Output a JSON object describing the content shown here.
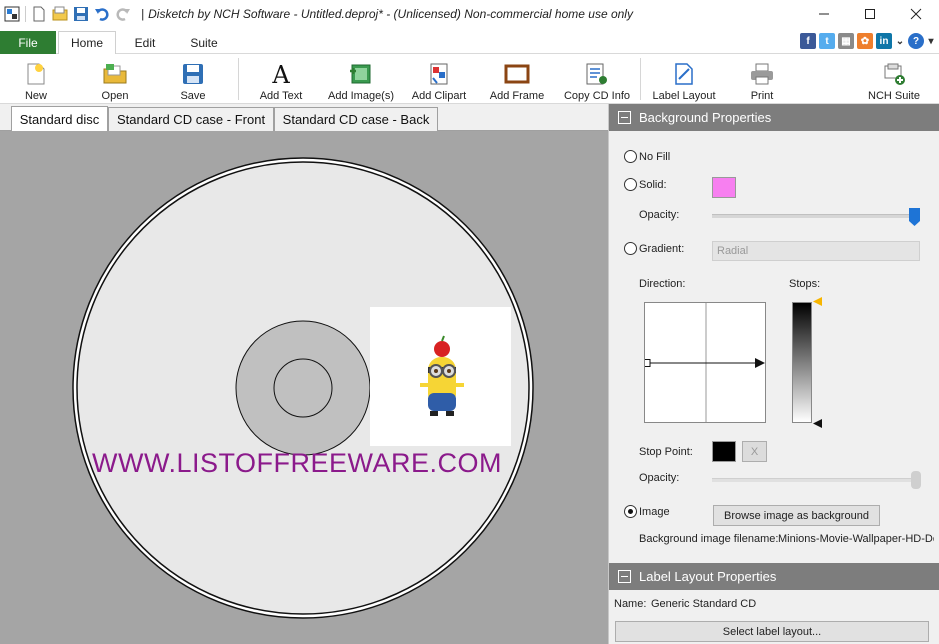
{
  "window": {
    "title": "Disketch by NCH Software - Untitled.deproj* - (Unlicensed) Non-commercial home use only",
    "separator": "|"
  },
  "menu": {
    "file": "File",
    "tabs": [
      "Home",
      "Edit",
      "Suite"
    ]
  },
  "toolbar": {
    "new": "New",
    "open": "Open",
    "save": "Save",
    "add_text": "Add Text",
    "add_images": "Add Image(s)",
    "add_clipart": "Add Clipart",
    "add_frame": "Add Frame",
    "copy_cd_info": "Copy CD Info",
    "label_layout": "Label Layout",
    "print": "Print",
    "nch_suite": "NCH Suite"
  },
  "doc_tabs": [
    "Standard disc",
    "Standard CD case - Front",
    "Standard CD case - Back"
  ],
  "canvas": {
    "watermark": "WWW.LISTOFFREEWARE.COM",
    "watermark_color": "#8b1a8b",
    "disc_color": "#e8e8e8",
    "background_color": "#a5a5a5"
  },
  "background_properties": {
    "header": "Background Properties",
    "no_fill": "No Fill",
    "solid": "Solid:",
    "solid_color": "#f77ff0",
    "opacity": "Opacity:",
    "opacity_level": 1.0,
    "gradient": "Gradient:",
    "gradient_type": "Radial",
    "direction": "Direction:",
    "stops": "Stops:",
    "stop_point": "Stop Point:",
    "stop_color": "#000000",
    "stop_remove": "X",
    "stop_opacity": "Opacity:",
    "image": "Image",
    "selected_option": "image",
    "browse_button": "Browse image as background",
    "filename_label": "Background image filename:",
    "filename_value": "Minions-Movie-Wallpaper-HD-De"
  },
  "label_layout_properties": {
    "header": "Label Layout Properties",
    "name_label": "Name:",
    "name_value": "Generic Standard CD",
    "select_button": "Select label layout..."
  }
}
